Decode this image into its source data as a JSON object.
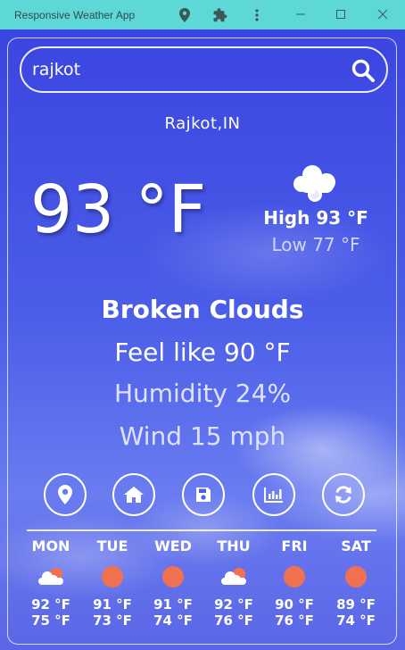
{
  "window": {
    "title": "Responsive Weather App",
    "icons": [
      "location-pin-icon",
      "extension-icon",
      "more-vert-icon"
    ],
    "controls": [
      "minimize",
      "maximize",
      "close"
    ]
  },
  "search": {
    "value": "rajkot",
    "placeholder": ""
  },
  "weather": {
    "city": "Rajkot,IN",
    "temperature": "93 °F",
    "condition_icon": "cloud-icon",
    "high": "High 93 °F",
    "low": "Low 77 °F",
    "condition": "Broken Clouds",
    "feels_like": "Feel like 90 °F",
    "humidity": "Humidity 24%",
    "wind": "Wind 15 mph"
  },
  "actions": [
    {
      "icon": "location-icon"
    },
    {
      "icon": "home-icon"
    },
    {
      "icon": "save-icon"
    },
    {
      "icon": "chart-icon"
    },
    {
      "icon": "refresh-icon"
    }
  ],
  "forecast": [
    {
      "day": "MON",
      "icon": "partly-cloudy-icon",
      "high": "92 °F",
      "low": "75 °F"
    },
    {
      "day": "TUE",
      "icon": "sun-icon",
      "high": "91 °F",
      "low": "73 °F"
    },
    {
      "day": "WED",
      "icon": "sun-icon",
      "high": "91 °F",
      "low": "74 °F"
    },
    {
      "day": "THU",
      "icon": "partly-cloudy-icon",
      "high": "92 °F",
      "low": "76 °F"
    },
    {
      "day": "FRI",
      "icon": "sun-icon",
      "high": "90 °F",
      "low": "76 °F"
    },
    {
      "day": "SAT",
      "icon": "sun-icon",
      "high": "89 °F",
      "low": "74 °F"
    }
  ],
  "colors": {
    "titlebar": "#5ed8d6",
    "background": "#3f55e6",
    "sun": "#ef7150",
    "text": "#ffffff"
  }
}
